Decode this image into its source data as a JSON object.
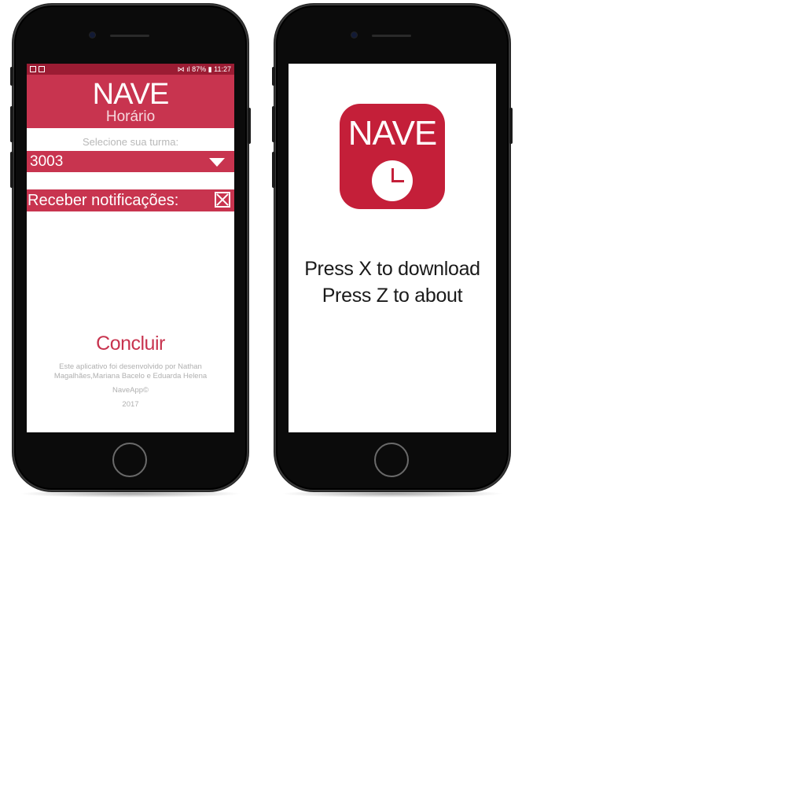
{
  "left_phone": {
    "statusbar": {
      "right_text": "87% ▮ 11:27",
      "battery": "87%",
      "time": "11:27"
    },
    "header": {
      "title": "NAVE",
      "subtitle": "Horário"
    },
    "select_label": "Selecione sua turma:",
    "turma_value": "3003",
    "notifications_label": "Receber notificações:",
    "notifications_checked": true,
    "concluir_label": "Concluir",
    "credits": "Este aplicativo foi desenvolvido por Nathan Magalhães,Mariana Bacelo e Eduarda Helena",
    "copyright": "NaveApp©",
    "year": "2017"
  },
  "right_phone": {
    "icon_title": "NAVE",
    "instructions": {
      "line1": "Press X to download",
      "line2": "Press Z to about"
    }
  },
  "colors": {
    "brand": "#c8344f",
    "status_bar": "#9b1c33",
    "icon_red": "#c41f39"
  }
}
